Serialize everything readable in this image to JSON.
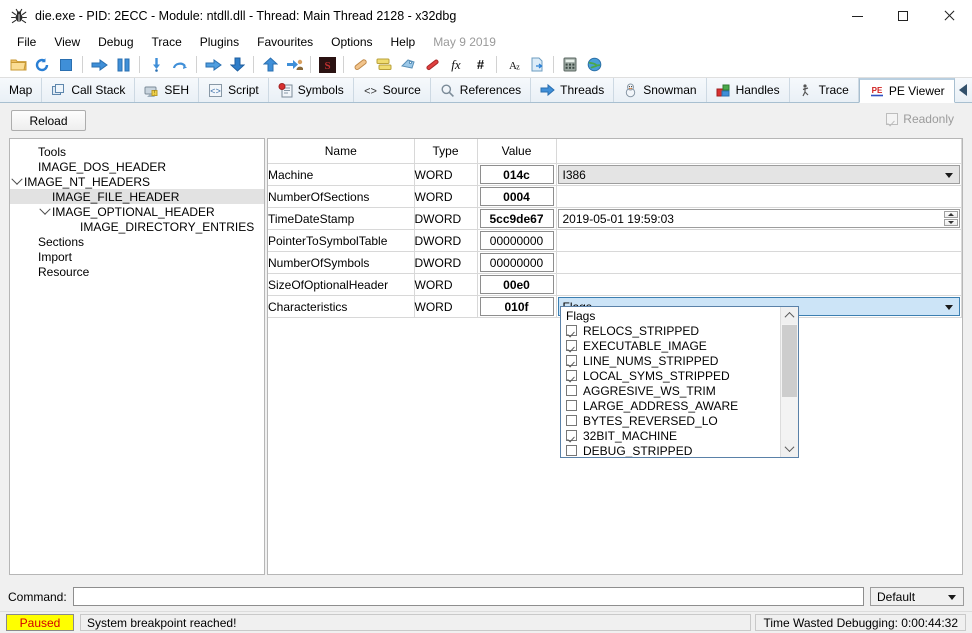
{
  "window": {
    "title": "die.exe - PID: 2ECC - Module: ntdll.dll - Thread: Main Thread 2128 - x32dbg",
    "icon": "bug-icon",
    "minimize": "minimize",
    "maximize": "maximize",
    "close": "close"
  },
  "menubar": {
    "items": [
      "File",
      "View",
      "Debug",
      "Trace",
      "Plugins",
      "Favourites",
      "Options",
      "Help"
    ],
    "date": "May 9 2019"
  },
  "toolbar": {
    "buttons": [
      {
        "name": "open-folder-icon",
        "glyph": "📁",
        "color": "#e8a33d"
      },
      {
        "name": "restart-icon",
        "glyph": "↺",
        "color": "#2a7fd4"
      },
      {
        "name": "stop-icon",
        "glyph": "■",
        "color": "#2a7fd4"
      },
      {
        "name": "run-icon",
        "glyph": "➡",
        "color": "#2a7fd4"
      },
      {
        "name": "pause-icon",
        "glyph": "▐▌",
        "color": "#2a7fd4"
      },
      {
        "name": "step-into-icon",
        "glyph": "↓",
        "color": "#2a7fd4"
      },
      {
        "name": "step-over-icon",
        "glyph": "↷",
        "color": "#2a7fd4"
      },
      {
        "name": "step-out-icon",
        "glyph": "⇨",
        "color": "#2a7fd4"
      },
      {
        "name": "run-to-icon",
        "glyph": "⇩",
        "color": "#1f5fbf"
      },
      {
        "name": "execute-till-return-icon",
        "glyph": "⇧",
        "color": "#2a7fd4"
      },
      {
        "name": "run-to-user-code-icon",
        "glyph": "⇢",
        "color": "#2a7fd4"
      },
      {
        "name": "scylla-icon",
        "glyph": "S",
        "color": "#b03030"
      },
      {
        "name": "patch-icon",
        "glyph": "╱",
        "color": "#e0b080"
      },
      {
        "name": "notes-icon",
        "glyph": "≣",
        "color": "#d8c34a"
      },
      {
        "name": "labels-icon",
        "glyph": "✐",
        "color": "#8ab9e0"
      },
      {
        "name": "bookmark-icon",
        "glyph": "╱",
        "color": "#d03030"
      },
      {
        "name": "functions-icon",
        "glyph": "fx",
        "color": "#1a1a1a"
      },
      {
        "name": "hash-icon",
        "glyph": "#",
        "color": "#1a1a1a"
      },
      {
        "name": "sort-az-icon",
        "glyph": "A₂",
        "color": "#1a1a1a"
      },
      {
        "name": "handles-page-icon",
        "glyph": "⎘",
        "color": "#7fa8cc"
      },
      {
        "name": "calculator-icon",
        "glyph": "⌸",
        "color": "#7a7a7a"
      },
      {
        "name": "globe-icon",
        "glyph": "●",
        "color": "#3a8a3a"
      }
    ]
  },
  "tabs": [
    {
      "label": "Map",
      "icon": "",
      "active": false
    },
    {
      "label": "Call Stack",
      "icon": "stack-icon",
      "active": false
    },
    {
      "label": "SEH",
      "icon": "seh-icon",
      "active": false
    },
    {
      "label": "Script",
      "icon": "script-icon",
      "active": false
    },
    {
      "label": "Symbols",
      "icon": "symbols-icon",
      "active": false
    },
    {
      "label": "Source",
      "icon": "source-icon",
      "active": false
    },
    {
      "label": "References",
      "icon": "references-icon",
      "active": false
    },
    {
      "label": "Threads",
      "icon": "threads-icon",
      "active": false
    },
    {
      "label": "Snowman",
      "icon": "snowman-icon",
      "active": false
    },
    {
      "label": "Handles",
      "icon": "handles-icon",
      "active": false
    },
    {
      "label": "Trace",
      "icon": "trace-icon",
      "active": false
    },
    {
      "label": "PE Viewer",
      "icon": "pe-icon",
      "active": true
    }
  ],
  "pe_viewer": {
    "reload_label": "Reload",
    "readonly_label": "Readonly",
    "readonly_checked": true,
    "tree": [
      {
        "label": "Tools",
        "depth": 1,
        "expander": "none",
        "selected": false
      },
      {
        "label": "IMAGE_DOS_HEADER",
        "depth": 1,
        "expander": "none",
        "selected": false
      },
      {
        "label": "IMAGE_NT_HEADERS",
        "depth": 1,
        "expander": "expanded",
        "selected": false
      },
      {
        "label": "IMAGE_FILE_HEADER",
        "depth": 2,
        "expander": "none",
        "selected": true
      },
      {
        "label": "IMAGE_OPTIONAL_HEADER",
        "depth": 2,
        "expander": "expanded",
        "selected": false
      },
      {
        "label": "IMAGE_DIRECTORY_ENTRIES",
        "depth": 3,
        "expander": "none",
        "selected": false
      },
      {
        "label": "Sections",
        "depth": 1,
        "expander": "none",
        "selected": false
      },
      {
        "label": "Import",
        "depth": 1,
        "expander": "none",
        "selected": false
      },
      {
        "label": "Resource",
        "depth": 1,
        "expander": "none",
        "selected": false
      }
    ],
    "table": {
      "headers": [
        "Name",
        "Type",
        "Value",
        ""
      ],
      "rows": [
        {
          "name": "Machine",
          "type": "WORD",
          "value": "014c",
          "bold": true,
          "extra": {
            "kind": "combo",
            "text": "I386",
            "state": "disabled"
          }
        },
        {
          "name": "NumberOfSections",
          "type": "WORD",
          "value": "0004",
          "bold": true,
          "extra": {
            "kind": "none",
            "text": ""
          }
        },
        {
          "name": "TimeDateStamp",
          "type": "DWORD",
          "value": "5cc9de67",
          "bold": true,
          "extra": {
            "kind": "spin",
            "text": "2019-05-01 19:59:03"
          }
        },
        {
          "name": "PointerToSymbolTable",
          "type": "DWORD",
          "value": "00000000",
          "bold": false,
          "extra": {
            "kind": "none",
            "text": ""
          }
        },
        {
          "name": "NumberOfSymbols",
          "type": "DWORD",
          "value": "00000000",
          "bold": false,
          "extra": {
            "kind": "none",
            "text": ""
          }
        },
        {
          "name": "SizeOfOptionalHeader",
          "type": "WORD",
          "value": "00e0",
          "bold": true,
          "extra": {
            "kind": "none",
            "text": ""
          }
        },
        {
          "name": "Characteristics",
          "type": "WORD",
          "value": "010f",
          "bold": true,
          "extra": {
            "kind": "combo",
            "text": "Flags",
            "state": "focused"
          }
        }
      ]
    },
    "flags_dropdown": {
      "open": true,
      "header": "Flags",
      "items": [
        {
          "label": "RELOCS_STRIPPED",
          "checked": true
        },
        {
          "label": "EXECUTABLE_IMAGE",
          "checked": true
        },
        {
          "label": "LINE_NUMS_STRIPPED",
          "checked": true
        },
        {
          "label": "LOCAL_SYMS_STRIPPED",
          "checked": true
        },
        {
          "label": "AGGRESIVE_WS_TRIM",
          "checked": false
        },
        {
          "label": "LARGE_ADDRESS_AWARE",
          "checked": false
        },
        {
          "label": "BYTES_REVERSED_LO",
          "checked": false
        },
        {
          "label": "32BIT_MACHINE",
          "checked": true
        },
        {
          "label": "DEBUG_STRIPPED",
          "checked": false
        }
      ]
    }
  },
  "command": {
    "label": "Command:",
    "value": "",
    "profile": "Default"
  },
  "status": {
    "state": "Paused",
    "message": "System breakpoint reached!",
    "time_wasted": "Time Wasted Debugging: 0:00:44:32"
  },
  "colors": {
    "paused_bg": "#ffff00",
    "paused_fg": "#d40000",
    "accent_selection": "#cce4f7",
    "tab_active_bg": "#ffffff"
  }
}
